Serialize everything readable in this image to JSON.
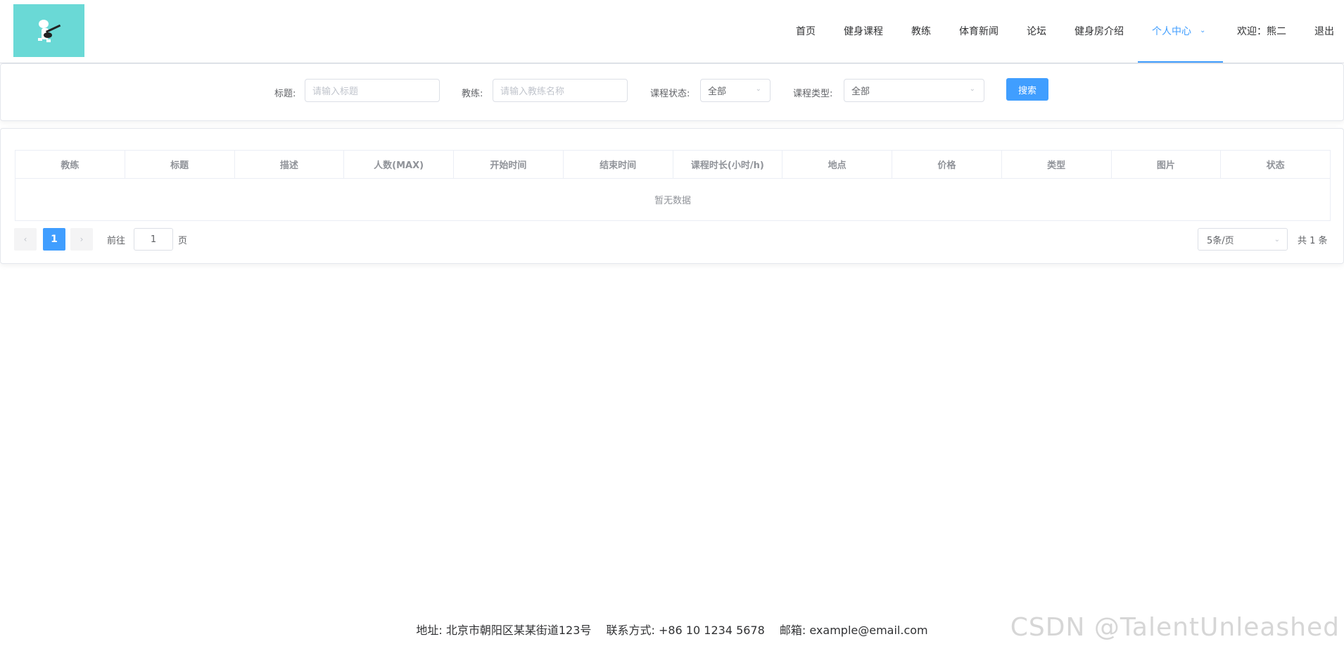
{
  "nav": {
    "items": [
      {
        "label": "首页"
      },
      {
        "label": "健身课程"
      },
      {
        "label": "教练"
      },
      {
        "label": "体育新闻"
      },
      {
        "label": "论坛"
      },
      {
        "label": "健身房介绍"
      },
      {
        "label": "个人中心"
      },
      {
        "label": "欢迎：熊二"
      },
      {
        "label": "退出"
      }
    ],
    "active_index": 6
  },
  "search": {
    "title_label": "标题:",
    "title_placeholder": "请输入标题",
    "coach_label": "教练:",
    "coach_placeholder": "请输入教练名称",
    "status_label": "课程状态:",
    "status_value": "全部",
    "type_label": "课程类型:",
    "type_value": "全部",
    "button_label": "搜索"
  },
  "table": {
    "columns": [
      "教练",
      "标题",
      "描述",
      "人数(MAX)",
      "开始时间",
      "结束时间",
      "课程时长(小时/h)",
      "地点",
      "价格",
      "类型",
      "图片",
      "状态"
    ],
    "empty_text": "暂无数据"
  },
  "pager": {
    "current_page": "1",
    "goto_label": "前往",
    "goto_value": "1",
    "page_unit": "页",
    "page_size": "5条/页",
    "total": "共 1 条"
  },
  "footer": {
    "address": "地址: 北京市朝阳区某某街道123号",
    "contact": "联系方式: +86 10 1234 5678",
    "email": "邮箱: example@email.com"
  },
  "watermark": "CSDN @TalentUnleashed"
}
